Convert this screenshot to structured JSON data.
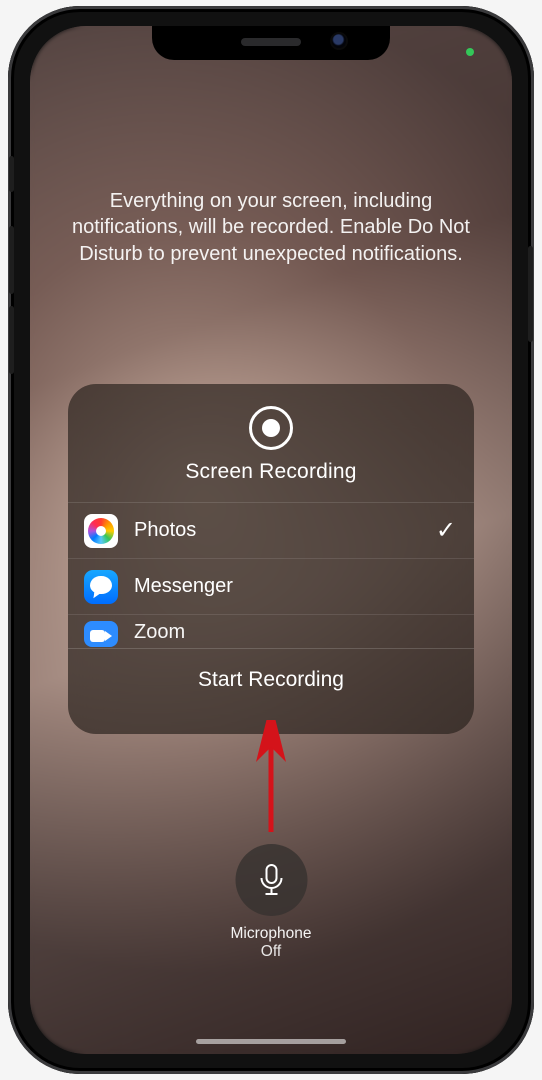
{
  "instructions": "Everything on your screen, including notifications, will be recorded. Enable Do Not Disturb to prevent unexpected notifications.",
  "card": {
    "title": "Screen Recording",
    "start_label": "Start Recording",
    "apps": [
      {
        "label": "Photos",
        "icon": "photos-icon",
        "selected": true
      },
      {
        "label": "Messenger",
        "icon": "messenger-icon",
        "selected": false
      },
      {
        "label": "Zoom",
        "icon": "zoom-icon",
        "selected": false
      }
    ]
  },
  "mic": {
    "label": "Microphone",
    "state": "Off"
  }
}
